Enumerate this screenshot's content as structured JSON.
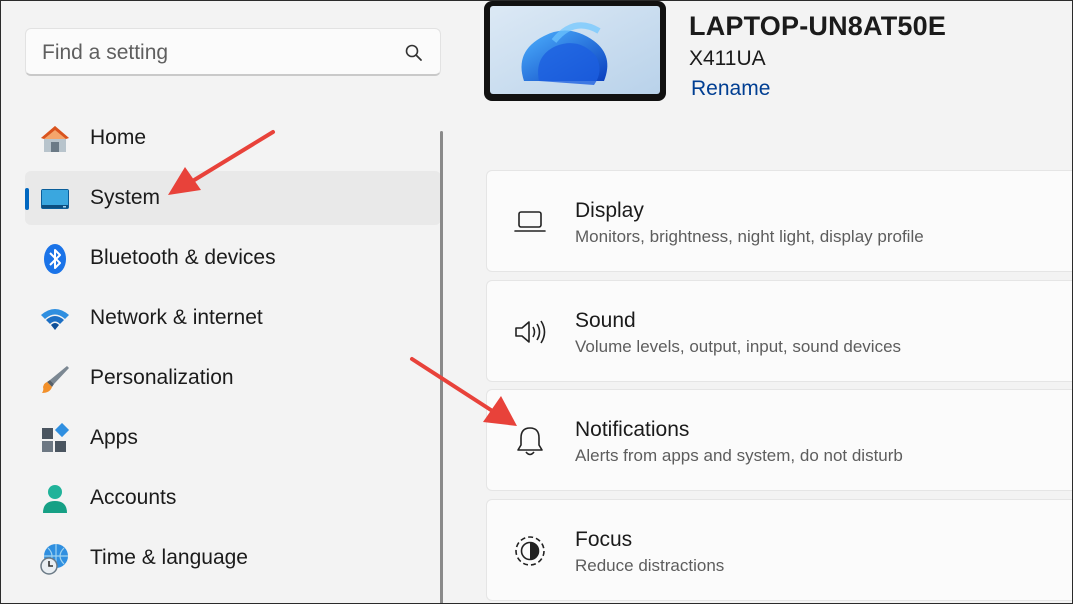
{
  "search": {
    "placeholder": "Find a setting",
    "icon": "search-icon"
  },
  "sidebar": {
    "items": [
      {
        "label": "Home",
        "icon": "home-icon"
      },
      {
        "label": "System",
        "icon": "system-icon",
        "selected": true
      },
      {
        "label": "Bluetooth & devices",
        "icon": "bluetooth-icon"
      },
      {
        "label": "Network & internet",
        "icon": "wifi-icon"
      },
      {
        "label": "Personalization",
        "icon": "brush-icon"
      },
      {
        "label": "Apps",
        "icon": "apps-icon"
      },
      {
        "label": "Accounts",
        "icon": "account-icon"
      },
      {
        "label": "Time & language",
        "icon": "globe-clock-icon"
      }
    ],
    "accent_color": "#0067c0"
  },
  "device": {
    "name": "LAPTOP-UN8AT50E",
    "model": "X411UA",
    "rename_label": "Rename"
  },
  "cards": [
    {
      "title": "Display",
      "subtitle": "Monitors, brightness, night light, display profile",
      "icon": "laptop-icon"
    },
    {
      "title": "Sound",
      "subtitle": "Volume levels, output, input, sound devices",
      "icon": "speaker-icon"
    },
    {
      "title": "Notifications",
      "subtitle": "Alerts from apps and system, do not disturb",
      "icon": "bell-icon"
    },
    {
      "title": "Focus",
      "subtitle": "Reduce distractions",
      "icon": "focus-icon"
    }
  ],
  "annotation_color": "#e8423a"
}
